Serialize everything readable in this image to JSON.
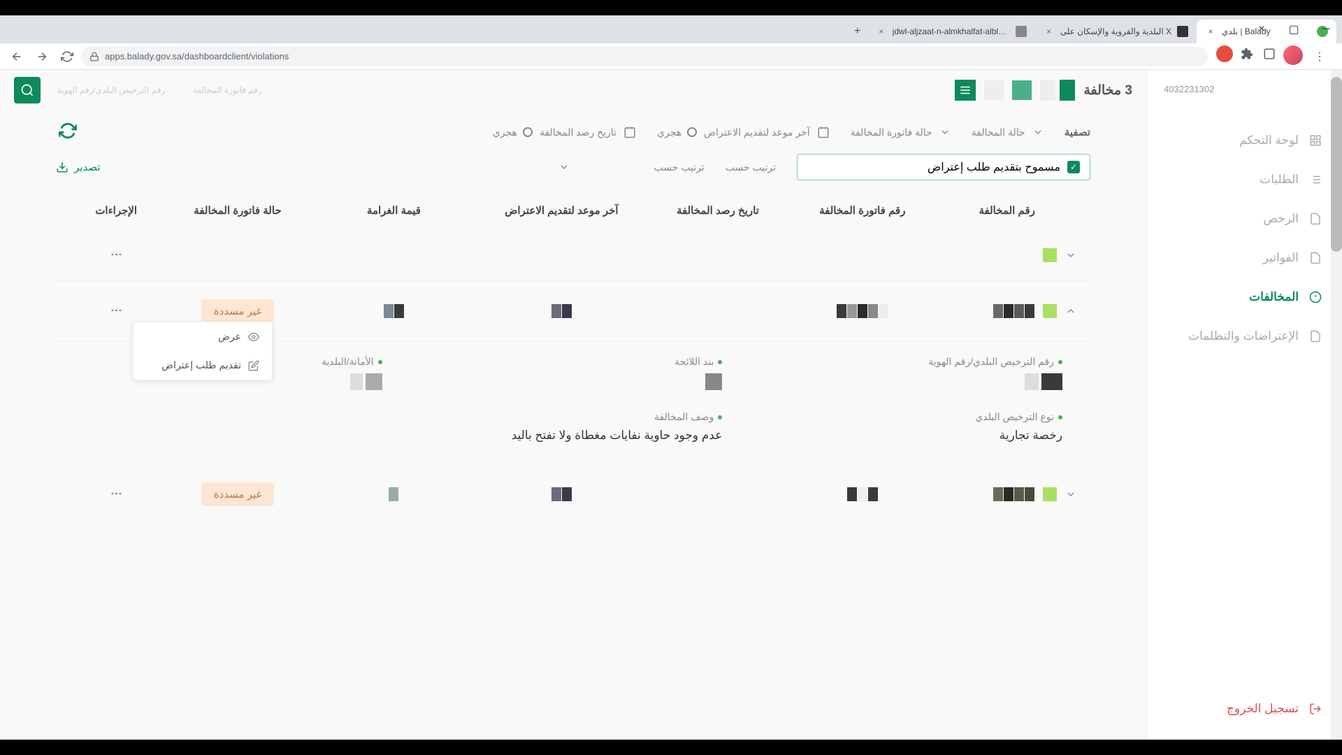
{
  "browser": {
    "tabs": [
      {
        "title": "بلدي | Balady"
      },
      {
        "title": "البلدية والقروية والإسكان على X"
      },
      {
        "title": "jdwl-aljzaat-n-almkhalfat-albldya"
      }
    ],
    "url": "apps.balady.gov.sa/dashboardclient/violations"
  },
  "sidebar": {
    "id": "4032231302",
    "items": [
      {
        "label": "لوحة التحكم"
      },
      {
        "label": "الطلبات"
      },
      {
        "label": "الرخص"
      },
      {
        "label": "الفواتير"
      },
      {
        "label": "المخالفات"
      },
      {
        "label": "الإعتراضات والتظلمات"
      }
    ],
    "logout": "تسجيل الخروج"
  },
  "topbar": {
    "count": "3 مخالفة",
    "input1": "رقم فاتورة المخالفة",
    "input2": "رقم الترخيص البلدي/رقم الهوية"
  },
  "filters": {
    "title": "تصفية",
    "violation_status": "حالة المخالفة",
    "invoice_status": "حالة فاتورة المخالفة",
    "hijri": "هجري",
    "objection_deadline": "آخر موعد لتقديم الاعتراض",
    "violation_date": "تاريخ رصد المخالفة"
  },
  "sort": {
    "checkbox_label": "مسموح بتقديم طلب إعتراض",
    "sort_by": "ترتيب حسب",
    "export": "تصدير"
  },
  "table": {
    "headers": {
      "violation_no": "رقم المخالفة",
      "invoice_no": "رقم فاتورة المخالفة",
      "date": "تاريخ رصد المخالفة",
      "deadline": "آخر موعد لتقديم الاعتراض",
      "amount": "قيمة الغرامة",
      "status": "حالة فاتورة المخالفة",
      "actions": "الإجراءات"
    },
    "status_unpaid": "غير مسددة"
  },
  "menu": {
    "view": "عرض",
    "submit_objection": "تقديم طلب إعتراض"
  },
  "details": {
    "license_id": "رقم الترخيص البلدي/رقم الهوية",
    "regulation": "بند اللائحة",
    "municipality": "الأمانة/البلدية",
    "license_type": "نوع الترخيص البلدي",
    "license_type_value": "رخصة تجارية",
    "description": "وصف المخالفة",
    "description_value": "عدم وجود حاوية نفايات مغطاة ولا تفتح باليد"
  }
}
